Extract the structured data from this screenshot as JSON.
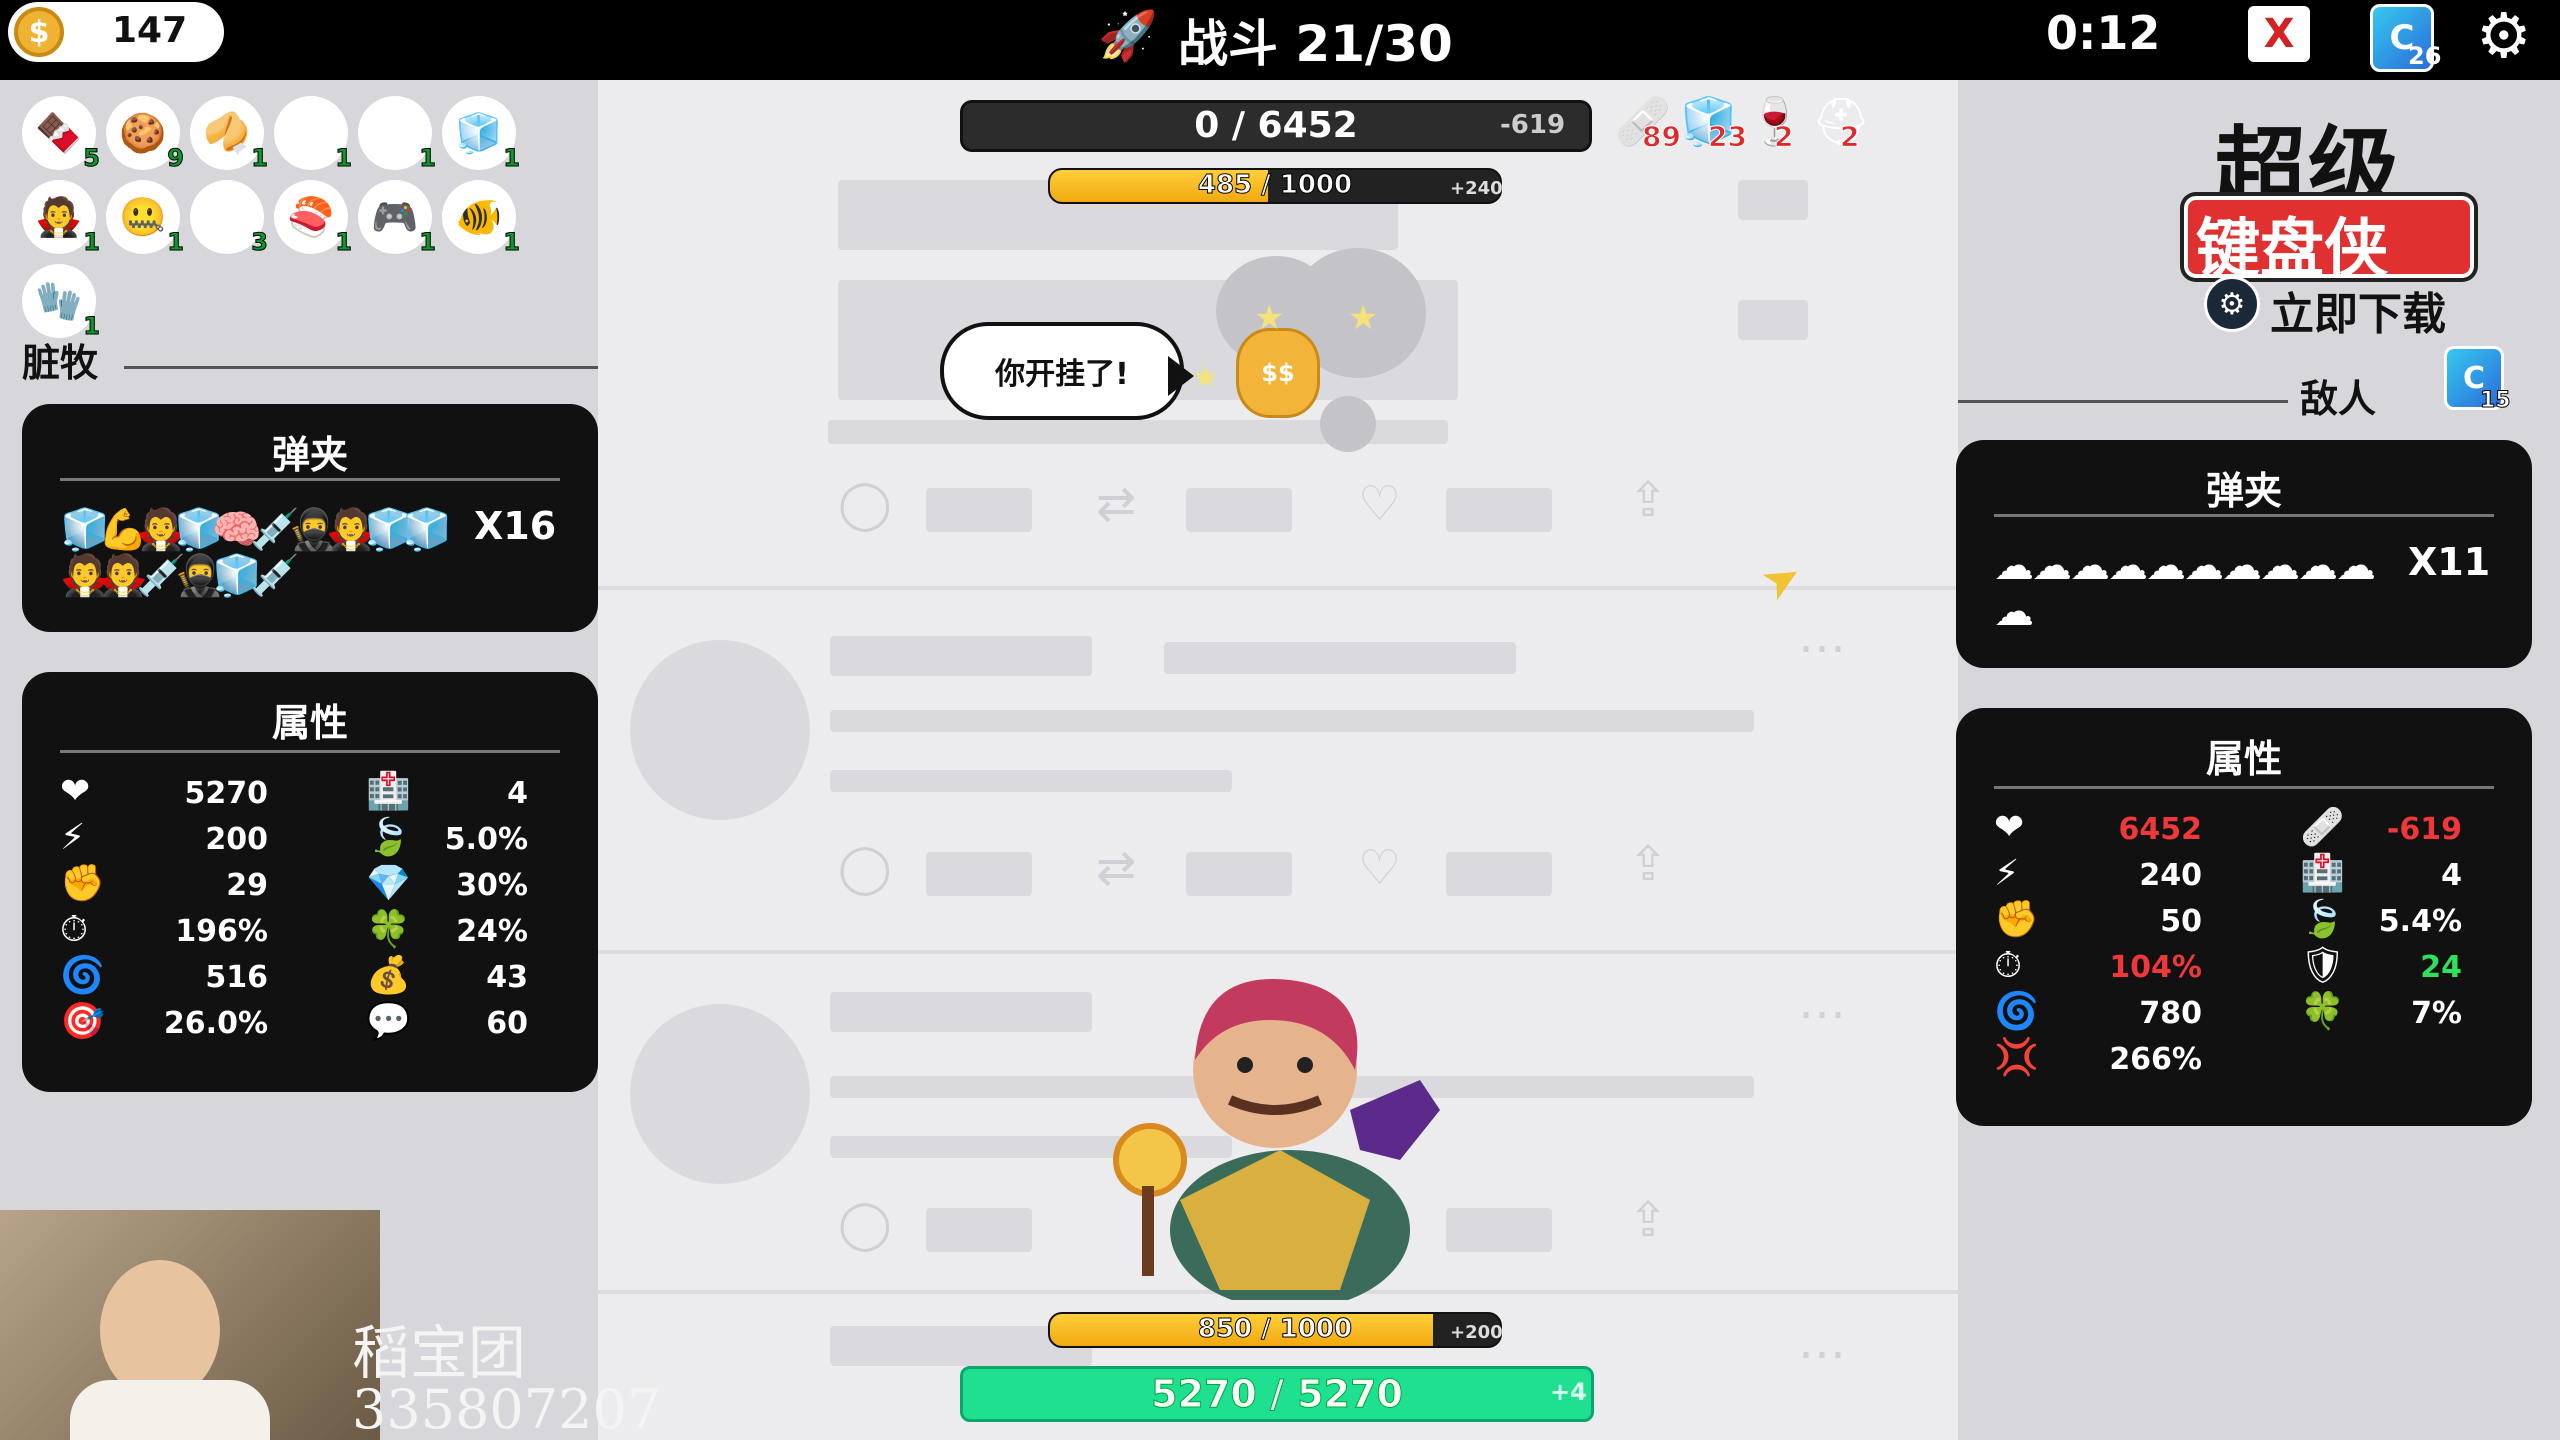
{
  "top_bar": {
    "coins": "147",
    "coin_symbol": "$",
    "battle_label": "战斗 21/30",
    "timer": "0:12",
    "deck_count": "26",
    "scroll_symbol": "X"
  },
  "player": {
    "name": "脏牧",
    "inventory": [
      {
        "icon": "chocolate-icon",
        "glyph": "🍫",
        "count": "5"
      },
      {
        "icon": "cookie-icon",
        "glyph": "🍪",
        "count": "9"
      },
      {
        "icon": "fortune-cookie-icon",
        "glyph": "🥠",
        "count": "1"
      },
      {
        "icon": "ticket-icon",
        "glyph": "🎟",
        "count": "1"
      },
      {
        "icon": "medal-icon",
        "glyph": "🎖",
        "count": "1"
      },
      {
        "icon": "ice-cube-icon",
        "glyph": "🧊",
        "count": "1"
      },
      {
        "icon": "vampire-icon",
        "glyph": "🧛",
        "count": "1"
      },
      {
        "icon": "zipper-mouth-face-icon",
        "glyph": "🤐",
        "count": "1"
      },
      {
        "icon": "chili-pepper-icon",
        "glyph": "🌶",
        "count": "3"
      },
      {
        "icon": "sushi-icon",
        "glyph": "🍣",
        "count": "1"
      },
      {
        "icon": "game-controller-icon",
        "glyph": "🎮",
        "count": "1"
      },
      {
        "icon": "fish-icon",
        "glyph": "🐠",
        "count": "1"
      },
      {
        "icon": "glove-icon",
        "glyph": "🧤",
        "count": "1"
      }
    ],
    "magazine": {
      "title": "弹夹",
      "multiplier": "X16",
      "glyphs": [
        "🧊",
        "💪",
        "🧛",
        "🧊",
        "🧠",
        "💉",
        "🥷",
        "🧛",
        "🧊",
        "🧊",
        "🧛",
        "🧛",
        "💉",
        "🥷",
        "🧊",
        "💉"
      ]
    },
    "attributes": {
      "title": "属性",
      "left": [
        {
          "icon": "heart-icon",
          "glyph": "❤",
          "value": "5270"
        },
        {
          "icon": "lightning-icon",
          "glyph": "⚡",
          "value": "200"
        },
        {
          "icon": "fist-icon",
          "glyph": "✊",
          "value": "29"
        },
        {
          "icon": "stopwatch-icon",
          "glyph": "⏱",
          "value": "196%"
        },
        {
          "icon": "vortex-icon",
          "glyph": "🌀",
          "value": "516"
        },
        {
          "icon": "target-icon",
          "glyph": "🎯",
          "value": "26.0%"
        }
      ],
      "right": [
        {
          "icon": "hospital-icon",
          "glyph": "🏥",
          "value": "4"
        },
        {
          "icon": "leaf-icon",
          "glyph": "🍃",
          "value": "5.0%"
        },
        {
          "icon": "diamond-icon",
          "glyph": "💎",
          "value": "30%"
        },
        {
          "icon": "clover-icon",
          "glyph": "🍀",
          "value": "24%"
        },
        {
          "icon": "money-bag-icon",
          "glyph": "💰",
          "value": "43"
        },
        {
          "icon": "speech-bubble-icon",
          "glyph": "💬",
          "value": "60"
        }
      ]
    },
    "xp": {
      "text": "850 / 1000",
      "bonus": "+200",
      "fraction": 0.85
    },
    "hp": {
      "text": "5270 / 5270",
      "regen": "+4"
    }
  },
  "enemy": {
    "label": "敌人",
    "card_count": "15",
    "hp": {
      "text": "0 / 6452",
      "delta": "-619"
    },
    "xp": {
      "text": "485 / 1000",
      "bonus": "+240",
      "fraction": 0.485
    },
    "status": [
      {
        "icon": "bandage-icon",
        "glyph": "🩹",
        "count": "89"
      },
      {
        "icon": "ice-cube-icon",
        "glyph": "🧊",
        "count": "23"
      },
      {
        "icon": "wine-glass-icon",
        "glyph": "🍷",
        "count": "2"
      },
      {
        "icon": "rescue-helmet-icon",
        "glyph": "⛑",
        "count": "2"
      }
    ],
    "speech": "你开挂了!",
    "magazine": {
      "title": "弹夹",
      "multiplier": "X11",
      "glyphs": [
        "☁",
        "☁",
        "☁",
        "☁",
        "☁",
        "☁",
        "☁",
        "☁",
        "☁",
        "☁",
        "☁"
      ]
    },
    "attributes": {
      "title": "属性",
      "left": [
        {
          "icon": "heart-icon",
          "glyph": "❤",
          "value": "6452",
          "color": "red"
        },
        {
          "icon": "lightning-icon",
          "glyph": "⚡",
          "value": "240",
          "color": "white"
        },
        {
          "icon": "fist-icon",
          "glyph": "✊",
          "value": "50",
          "color": "white"
        },
        {
          "icon": "stopwatch-icon",
          "glyph": "⏱",
          "value": "104%",
          "color": "red"
        },
        {
          "icon": "vortex-icon",
          "glyph": "🌀",
          "value": "780",
          "color": "white"
        },
        {
          "icon": "anger-icon",
          "glyph": "💢",
          "value": "266%",
          "color": "white"
        }
      ],
      "right": [
        {
          "icon": "bandage-icon",
          "glyph": "🩹",
          "value": "-619",
          "color": "red"
        },
        {
          "icon": "hospital-icon",
          "glyph": "🏥",
          "value": "4",
          "color": "white"
        },
        {
          "icon": "leaf-icon",
          "glyph": "🍃",
          "value": "5.4%",
          "color": "white"
        },
        {
          "icon": "shield-icon",
          "glyph": "🛡",
          "value": "24",
          "color": "green"
        },
        {
          "icon": "clover-icon",
          "glyph": "🍀",
          "value": "7%",
          "color": "white"
        }
      ]
    }
  },
  "logo": {
    "line1": "超级",
    "line2": "键盘侠",
    "download": "立即下载"
  },
  "stream": {
    "name": "稻宝团",
    "id": "335807207"
  }
}
